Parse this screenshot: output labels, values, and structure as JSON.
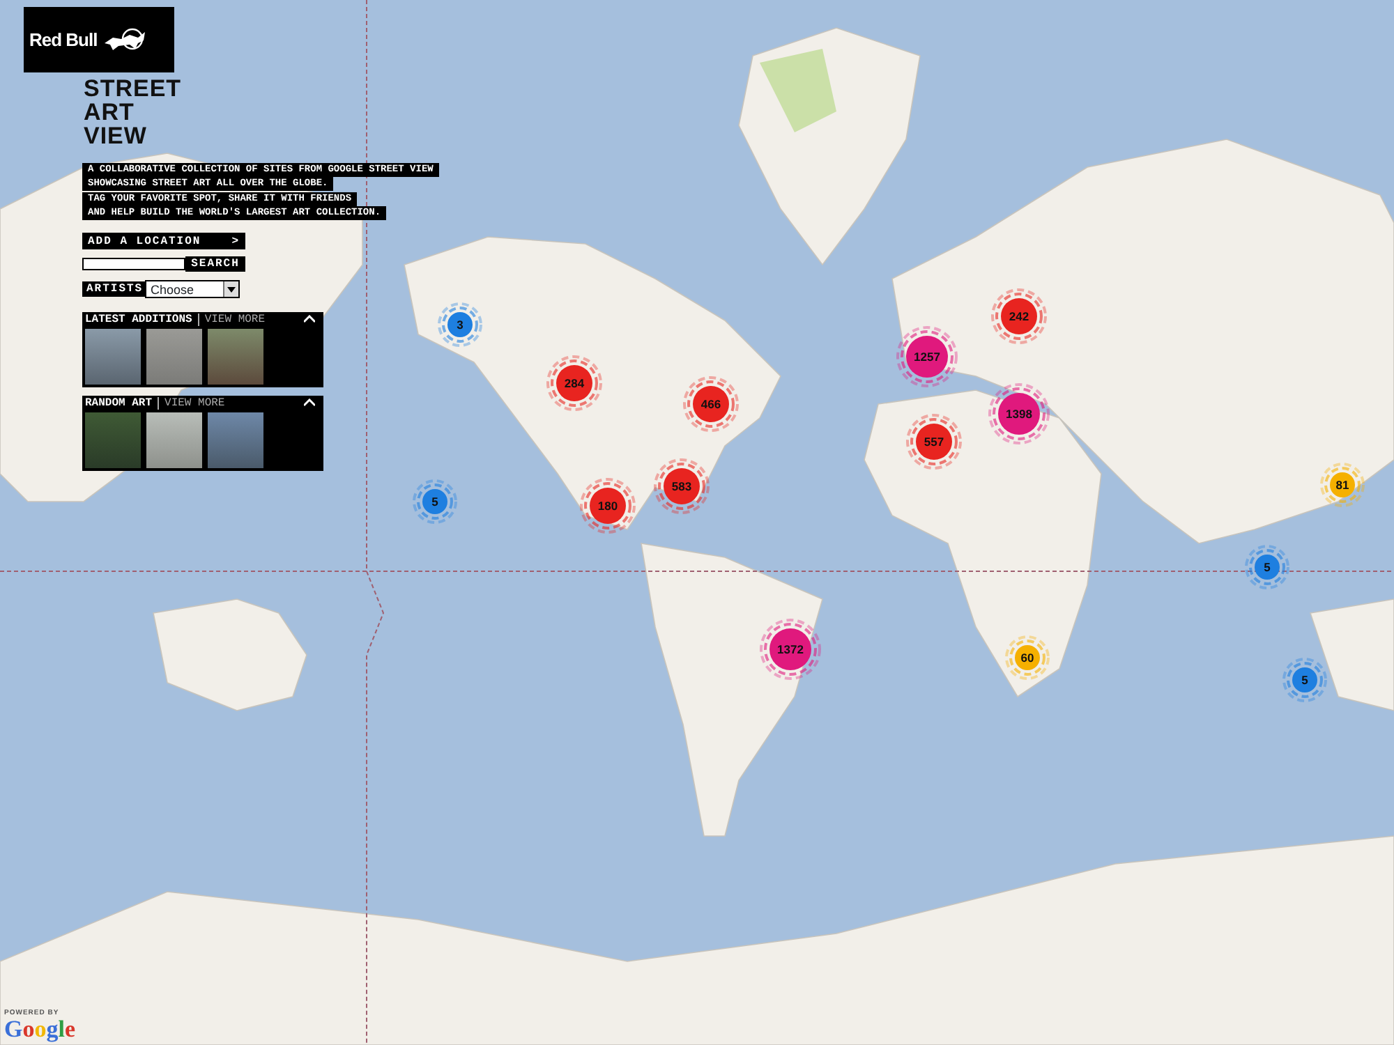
{
  "brand": {
    "logo_text": "Red Bull",
    "title_lines": [
      "STREET",
      "ART",
      "VIEW"
    ]
  },
  "description_lines": [
    "A COLLABORATIVE COLLECTION OF SITES FROM GOOGLE STREET VIEW",
    "SHOWCASING STREET ART ALL OVER THE GLOBE.",
    "TAG YOUR FAVORITE SPOT, SHARE IT WITH FRIENDS",
    "AND HELP BUILD THE WORLD'S LARGEST ART COLLECTION."
  ],
  "add_location": {
    "label": "ADD A LOCATION",
    "arrow": ">"
  },
  "search": {
    "button": "SEARCH"
  },
  "artists": {
    "label": "ARTISTS",
    "value": "Choose"
  },
  "sections": [
    {
      "title": "LATEST ADDITIONS",
      "link": "VIEW MORE",
      "expanded": true
    },
    {
      "title": "RANDOM ART",
      "link": "VIEW MORE",
      "expanded": true
    }
  ],
  "clusters": [
    {
      "count": "3",
      "color": "#1e7fe0"
    },
    {
      "count": "284",
      "color": "#e82420"
    },
    {
      "count": "466",
      "color": "#e82420"
    },
    {
      "count": "5",
      "color": "#1e7fe0"
    },
    {
      "count": "180",
      "color": "#e82420"
    },
    {
      "count": "583",
      "color": "#e82420"
    },
    {
      "count": "1257",
      "color": "#e0197d"
    },
    {
      "count": "242",
      "color": "#e82420"
    },
    {
      "count": "1398",
      "color": "#e0197d"
    },
    {
      "count": "557",
      "color": "#e82420"
    },
    {
      "count": "1372",
      "color": "#e0197d"
    },
    {
      "count": "60",
      "color": "#f5b000"
    },
    {
      "count": "81",
      "color": "#f5b000"
    },
    {
      "count": "5",
      "color": "#1e7fe0"
    },
    {
      "count": "5",
      "color": "#1e7fe0"
    }
  ],
  "footer": {
    "powered_by": "POWERED BY",
    "google": "Google"
  }
}
